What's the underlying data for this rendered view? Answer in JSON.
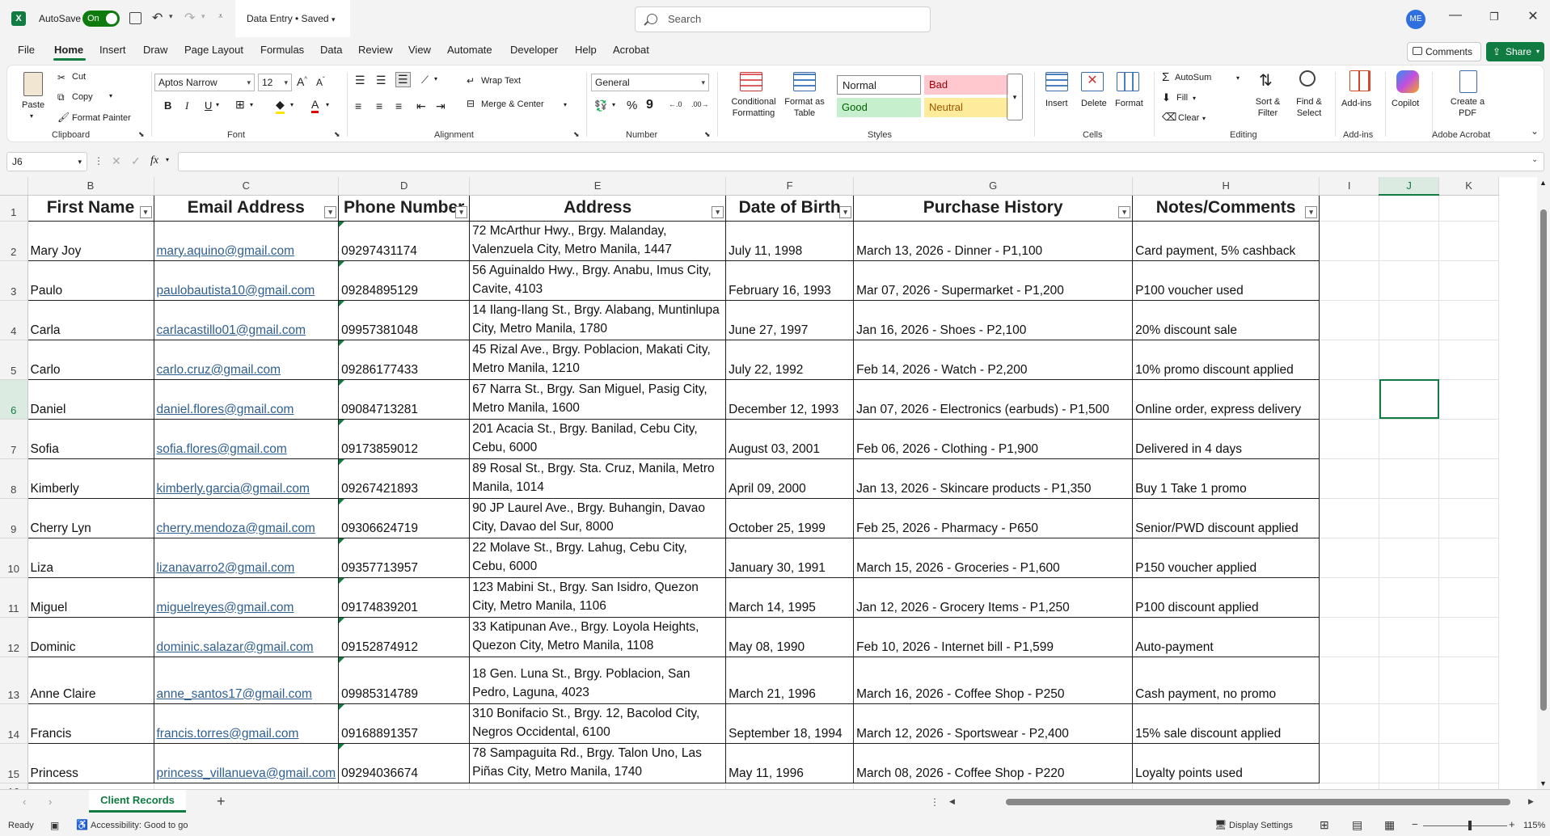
{
  "titlebar": {
    "autosave_label": "AutoSave",
    "autosave_state": "On",
    "doc_title": "Data Entry • Saved",
    "search_placeholder": "Search",
    "user_initials": "ME"
  },
  "menu": {
    "items": [
      "File",
      "Home",
      "Insert",
      "Draw",
      "Page Layout",
      "Formulas",
      "Data",
      "Review",
      "View",
      "Automate",
      "Developer",
      "Help",
      "Acrobat"
    ],
    "comments": "Comments",
    "share": "Share"
  },
  "ribbon": {
    "clipboard": {
      "paste": "Paste",
      "cut": "Cut",
      "copy": "Copy",
      "format_painter": "Format Painter",
      "label": "Clipboard"
    },
    "font": {
      "name": "Aptos Narrow",
      "size": "12",
      "bold": "B",
      "italic": "I",
      "underline": "U",
      "label": "Font"
    },
    "alignment": {
      "wrap": "Wrap Text",
      "merge": "Merge & Center",
      "label": "Alignment"
    },
    "number": {
      "format": "General",
      "label": "Number"
    },
    "styles": {
      "conditional": "Conditional Formatting",
      "format_table": "Format as Table",
      "normal": "Normal",
      "bad": "Bad",
      "good": "Good",
      "neutral": "Neutral",
      "label": "Styles"
    },
    "cells": {
      "insert": "Insert",
      "delete": "Delete",
      "format": "Format",
      "label": "Cells"
    },
    "editing": {
      "autosum": "AutoSum",
      "fill": "Fill",
      "clear": "Clear",
      "sort": "Sort & Filter",
      "find": "Find & Select",
      "label": "Editing"
    },
    "addins": {
      "addins": "Add-ins",
      "label": "Add-ins"
    },
    "copilot": "Copilot",
    "acrobat": {
      "create": "Create a PDF",
      "label": "Adobe Acrobat"
    }
  },
  "formula_bar": {
    "name_box": "J6",
    "fx": "fx",
    "value": ""
  },
  "columns": [
    "B",
    "C",
    "D",
    "E",
    "F",
    "G",
    "H",
    "I",
    "J",
    "K"
  ],
  "headers": [
    "First Name",
    "Email Address",
    "Phone Number",
    "Address",
    "Date of Birth",
    "Purchase History",
    "Notes/Comments"
  ],
  "rows": [
    {
      "n": "2",
      "first": "Mary Joy",
      "email": "mary.aquino@gmail.com",
      "phone": "09297431174",
      "address": "72 McArthur Hwy., Brgy. Malanday, Valenzuela City, Metro Manila, 1447",
      "dob": "July 11, 1998",
      "purchase": "March 13, 2026 - Dinner - P1,100",
      "notes": "Card payment, 5% cashback"
    },
    {
      "n": "3",
      "first": "Paulo",
      "email": "paulobautista10@gmail.com",
      "phone": "09284895129",
      "address": "56 Aguinaldo Hwy., Brgy. Anabu, Imus City, Cavite, 4103",
      "dob": "February 16, 1993",
      "purchase": "Mar 07, 2026 - Supermarket - P1,200",
      "notes": "P100 voucher used"
    },
    {
      "n": "4",
      "first": "Carla",
      "email": "carlacastillo01@gmail.com",
      "phone": "09957381048",
      "address": "14 Ilang-Ilang St., Brgy. Alabang, Muntinlupa City, Metro Manila, 1780",
      "dob": "June 27, 1997",
      "purchase": "Jan 16, 2026 - Shoes - P2,100",
      "notes": "20% discount sale"
    },
    {
      "n": "5",
      "first": "Carlo",
      "email": "carlo.cruz@gmail.com",
      "phone": "09286177433",
      "address": "45 Rizal Ave., Brgy. Poblacion, Makati City, Metro Manila, 1210",
      "dob": "July 22, 1992",
      "purchase": "Feb 14, 2026 - Watch - P2,200",
      "notes": "10% promo discount applied"
    },
    {
      "n": "6",
      "first": "Daniel",
      "email": "daniel.flores@gmail.com",
      "phone": "09084713281",
      "address": "67 Narra St., Brgy. San Miguel, Pasig City, Metro Manila, 1600",
      "dob": "December 12, 1993",
      "purchase": "Jan 07, 2026 - Electronics (earbuds) - P1,500",
      "notes": "Online order, express delivery"
    },
    {
      "n": "7",
      "first": "Sofia",
      "email": "sofia.flores@gmail.com",
      "phone": "09173859012",
      "address": "201 Acacia St., Brgy. Banilad, Cebu City, Cebu, 6000",
      "dob": "August 03, 2001",
      "purchase": "Feb 06, 2026 - Clothing - P1,900",
      "notes": "Delivered in 4 days"
    },
    {
      "n": "8",
      "first": "Kimberly",
      "email": "kimberly.garcia@gmail.com",
      "phone": "09267421893",
      "address": "89 Rosal St., Brgy. Sta. Cruz, Manila, Metro Manila, 1014",
      "dob": "April 09, 2000",
      "purchase": "Jan 13, 2026 - Skincare products - P1,350",
      "notes": "Buy 1 Take 1 promo"
    },
    {
      "n": "9",
      "first": "Cherry Lyn",
      "email": "cherry.mendoza@gmail.com",
      "phone": "09306624719",
      "address": "90 JP Laurel Ave., Brgy. Buhangin, Davao City, Davao del Sur, 8000",
      "dob": "October 25, 1999",
      "purchase": "Feb 25, 2026 - Pharmacy - P650",
      "notes": "Senior/PWD discount applied"
    },
    {
      "n": "10",
      "first": "Liza",
      "email": "lizanavarro2@gmail.com",
      "phone": "09357713957",
      "address": "22 Molave St., Brgy. Lahug, Cebu City, Cebu, 6000",
      "dob": "January 30, 1991",
      "purchase": "March 15, 2026 - Groceries - P1,600",
      "notes": "P150 voucher applied"
    },
    {
      "n": "11",
      "first": "Miguel",
      "email": "miguelreyes@gmail.com",
      "phone": "09174839201",
      "address": "123 Mabini St., Brgy. San Isidro, Quezon City, Metro Manila, 1106",
      "dob": "March 14, 1995",
      "purchase": "Jan 12, 2026 - Grocery Items - P1,250",
      "notes": "P100 discount applied"
    },
    {
      "n": "12",
      "first": "Dominic",
      "email": "dominic.salazar@gmail.com",
      "phone": "09152874912",
      "address": "33 Katipunan Ave., Brgy. Loyola Heights, Quezon City, Metro Manila, 1108",
      "dob": "May 08, 1990",
      "purchase": "Feb 10, 2026 - Internet bill - P1,599",
      "notes": "Auto-payment"
    },
    {
      "n": "13",
      "first": "Anne Claire",
      "email": "anne_santos17@gmail.com",
      "phone": "09985314789",
      "address": "18 Gen. Luna St., Brgy. Poblacion, San Pedro, Laguna, 4023",
      "dob": "March 21, 1996",
      "purchase": "March 16, 2026 - Coffee Shop - P250",
      "notes": "Cash payment, no promo"
    },
    {
      "n": "14",
      "first": "Francis",
      "email": "francis.torres@gmail.com",
      "phone": "09168891357",
      "address": "310 Bonifacio St., Brgy. 12, Bacolod City, Negros Occidental, 6100",
      "dob": "September 18, 1994",
      "purchase": "March 12, 2026 - Sportswear - P2,400",
      "notes": "15% sale discount applied"
    },
    {
      "n": "15",
      "first": "Princess",
      "email": "princess_villanueva@gmail.com",
      "phone": "09294036674",
      "address": "78 Sampaguita Rd., Brgy. Talon Uno, Las Piñas City, Metro Manila, 1740",
      "dob": "May 11, 1996",
      "purchase": "March 08, 2026 - Coffee Shop - P220",
      "notes": "Loyalty points used"
    }
  ],
  "sheet_tab": "Client Records",
  "status": {
    "ready": "Ready",
    "accessibility": "Accessibility: Good to go",
    "display_settings": "Display Settings",
    "zoom": "115%"
  }
}
